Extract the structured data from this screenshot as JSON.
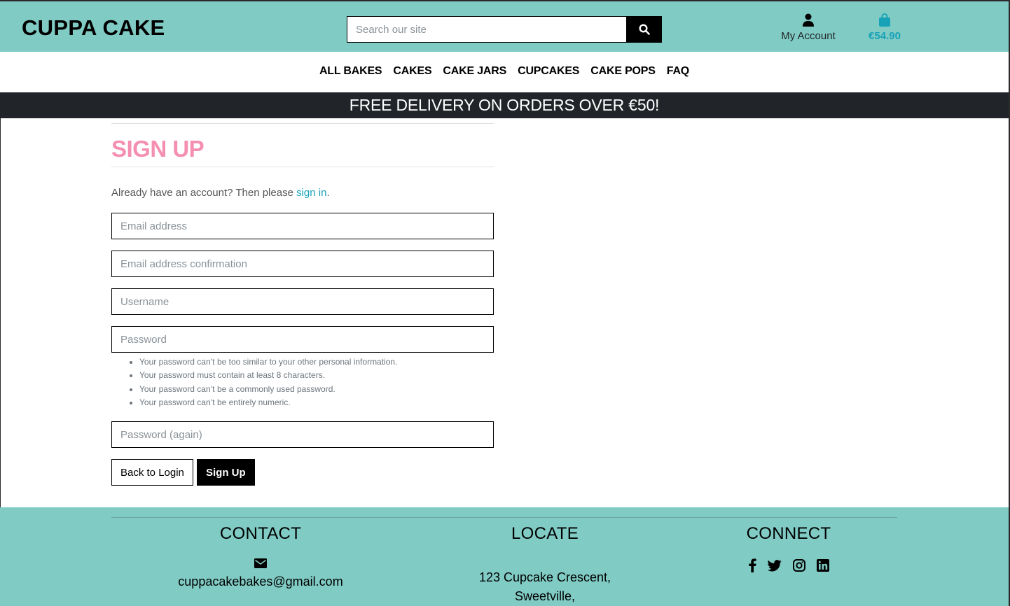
{
  "header": {
    "brand": "CUPPA CAKE",
    "search_placeholder": "Search our site",
    "account_label": "My Account",
    "bag_total": "€54.90"
  },
  "nav": {
    "items": [
      "ALL BAKES",
      "CAKES",
      "CAKE JARS",
      "CUPCAKES",
      "CAKE POPS",
      "FAQ"
    ]
  },
  "banner": "FREE DELIVERY ON ORDERS OVER €50!",
  "signup": {
    "title": "SIGN UP",
    "intro_text": "Already have an account? Then please ",
    "signin_link": "sign in",
    "intro_end": ".",
    "fields": {
      "email": "Email address",
      "email_confirm": "Email address confirmation",
      "username": "Username",
      "password": "Password",
      "password_again": "Password (again)"
    },
    "password_help": [
      "Your password can’t be too similar to your other personal information.",
      "Your password must contain at least 8 characters.",
      "Your password can’t be a commonly used password.",
      "Your password can’t be entirely numeric."
    ],
    "back_button": "Back to Login",
    "submit_button": "Sign Up"
  },
  "footer": {
    "contact_title": "CONTACT",
    "contact_email": "cuppacakebakes@gmail.com",
    "locate_title": "LOCATE",
    "address_line1": "123 Cupcake Crescent,",
    "address_line2": "Sweetville,",
    "connect_title": "CONNECT",
    "social_icons": [
      "facebook-icon",
      "twitter-icon",
      "instagram-icon",
      "linkedin-icon"
    ]
  },
  "colors": {
    "teal": "#80cbc4",
    "pink": "#f48fb1",
    "link": "#17a2b8",
    "dark": "#212529"
  }
}
